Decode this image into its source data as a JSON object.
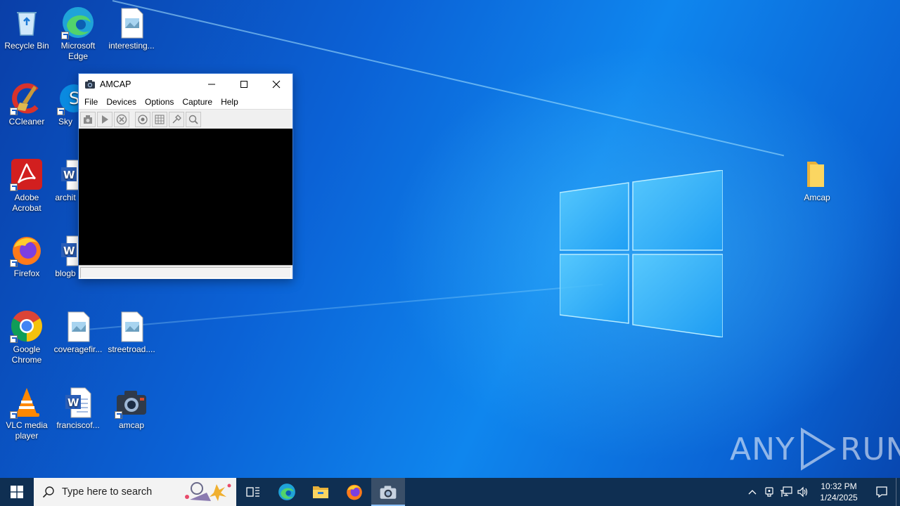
{
  "desktop": {
    "icons": [
      {
        "label": "Recycle Bin",
        "icon": "recycle-bin-icon"
      },
      {
        "label": "Microsoft Edge",
        "icon": "edge-icon"
      },
      {
        "label": "interesting...",
        "icon": "image-file-icon"
      },
      {
        "label": "CCleaner",
        "icon": "ccleaner-icon"
      },
      {
        "label": "Sky",
        "icon": "skype-icon"
      },
      {
        "label": "Adobe Acrobat",
        "icon": "acrobat-icon"
      },
      {
        "label": "archit",
        "icon": "word-doc-icon"
      },
      {
        "label": "Firefox",
        "icon": "firefox-icon"
      },
      {
        "label": "blogb",
        "icon": "word-doc-icon"
      },
      {
        "label": "Google Chrome",
        "icon": "chrome-icon"
      },
      {
        "label": "coveragefir...",
        "icon": "image-file-icon"
      },
      {
        "label": "streetroad....",
        "icon": "image-file-icon"
      },
      {
        "label": "VLC media player",
        "icon": "vlc-icon"
      },
      {
        "label": "franciscof...",
        "icon": "word-doc-icon"
      },
      {
        "label": "amcap",
        "icon": "camera-icon"
      },
      {
        "label": "Amcap",
        "icon": "folder-icon"
      }
    ]
  },
  "window": {
    "title": "AMCAP",
    "menu": [
      "File",
      "Devices",
      "Options",
      "Capture",
      "Help"
    ],
    "toolbar": [
      "capture-icon",
      "play-icon",
      "stop-icon",
      "preview-icon",
      "grid-icon",
      "tools-icon",
      "zoom-icon"
    ]
  },
  "taskbar": {
    "search_placeholder": "Type here to search",
    "apps": [
      "task-view-icon",
      "edge-icon",
      "file-explorer-icon",
      "firefox-icon",
      "amcap-icon"
    ],
    "time": "10:32 PM",
    "date": "1/24/2025"
  },
  "watermark": {
    "text_left": "ANY",
    "text_right": "RUN"
  },
  "colors": {
    "taskbar": "#0f2f52",
    "wallpaper_accent": "#0f86ee",
    "window_border": "#3d7bd6"
  }
}
